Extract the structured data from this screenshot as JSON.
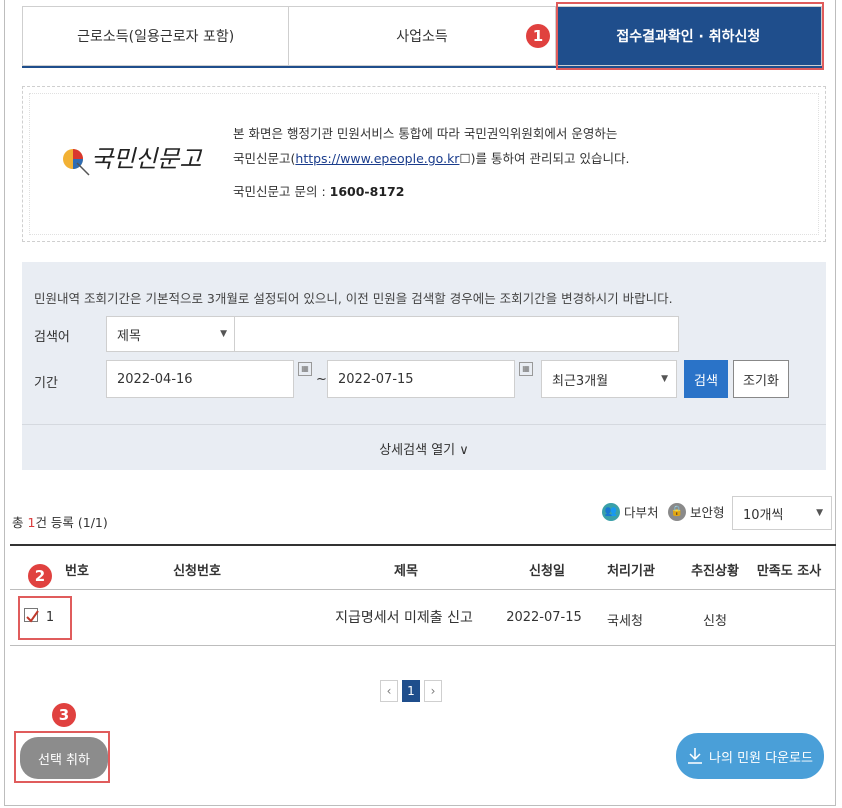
{
  "tabs": [
    {
      "label": "근로소득(일용근로자 포함)"
    },
    {
      "label": "사업소득"
    },
    {
      "label": "접수결과확인 · 취하신청"
    }
  ],
  "markers": [
    "1",
    "2",
    "3"
  ],
  "notice": {
    "logo_text": "국민신문고",
    "line1": "본 화면은 행정기관 민원서비스 통합에 따라 국민권익위원회에서 운영하는",
    "line2_prefix": "국민신문고(",
    "line2_link": "https://www.epeople.go.kr",
    "line2_suffix": ")를 통하여 관리되고 있습니다.",
    "contact_label": "국민신문고 문의 : ",
    "contact_number": "1600-8172"
  },
  "search": {
    "description": "민원내역 조회기간은 기본적으로 3개월로 설정되어 있으니, 이전 민원을 검색할 경우에는 조회기간을 변경하시기 바랍니다.",
    "keyword_label": "검색어",
    "keyword_type": "제목",
    "keyword_value": "",
    "period_label": "기간",
    "start_date": "2022-04-16",
    "separator": "~",
    "end_date": "2022-07-15",
    "range": "최근3개월",
    "search_button": "검색",
    "reset_button": "조기화",
    "detail_toggle": "상세검색 열기 ∨"
  },
  "list": {
    "total_prefix": "총 ",
    "total_count": "1",
    "total_suffix": "건 등록 (1/1)",
    "legend_multi": "다부처",
    "legend_secure": "보안형",
    "page_size": "10개씩",
    "columns": [
      "번호",
      "신청번호",
      "제목",
      "신청일",
      "처리기관",
      "추진상황",
      "만족도 조사"
    ],
    "rows": [
      {
        "no": "1",
        "apply_no": "",
        "title": "지급명세서 미제출 신고",
        "date": "2022-07-15",
        "agency": "국세청",
        "status": "신청",
        "survey": ""
      }
    ]
  },
  "pagination": {
    "prev": "‹",
    "current": "1",
    "next": "›"
  },
  "footer": {
    "cancel_button": "선택 취하",
    "download_button": "나의 민원 다운로드"
  },
  "colors": {
    "active_tab": "#1f4e8c",
    "highlight": "#e05c5c",
    "marker": "#e0413f",
    "search_button": "#2a73c8",
    "download_button": "#4a9fd8"
  }
}
